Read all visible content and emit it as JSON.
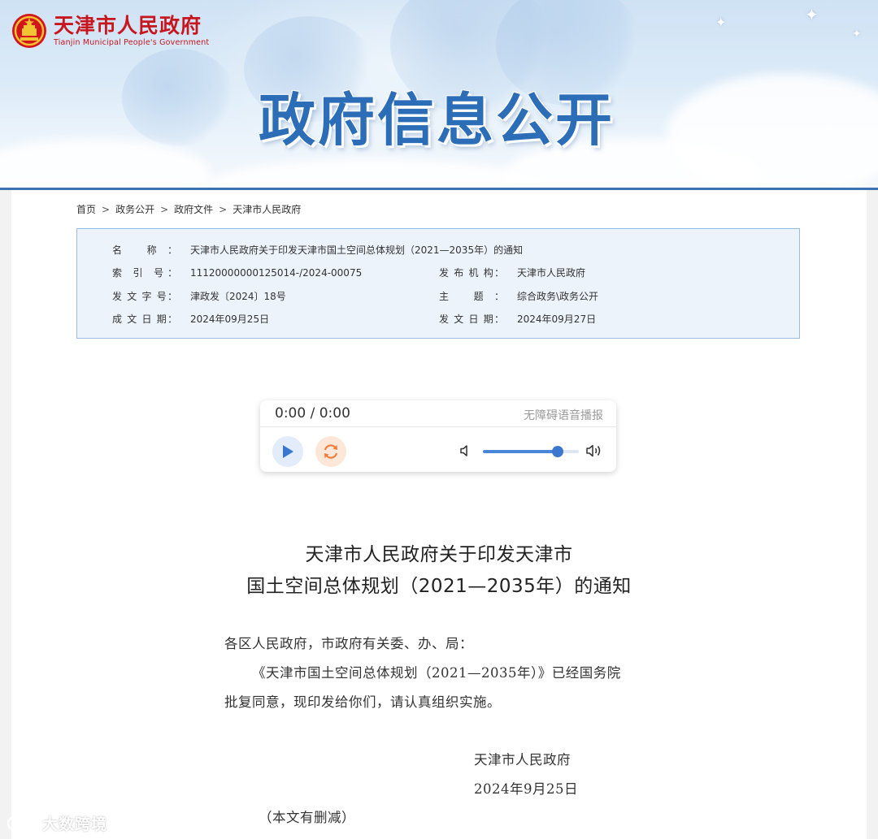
{
  "header": {
    "site_name_cn": "天津市人民政府",
    "site_name_en": "Tianjin Municipal People's Government",
    "banner_title": "政府信息公开"
  },
  "breadcrumb": [
    "首页",
    "政务公开",
    "政府文件",
    "天津市人民政府"
  ],
  "meta": {
    "name_label": "名 称：",
    "name_value": "天津市人民政府关于印发天津市国土空间总体规划（2021—2035年）的通知",
    "index_label": "索 引 号：",
    "index_value": "11120000000125014-/2024-00075",
    "issuer_label": "发 布 机 构：",
    "issuer_value": "天津市人民政府",
    "doc_no_label": "发 文 字 号：",
    "doc_no_value": "津政发〔2024〕18号",
    "topic_label": "主 题：",
    "topic_value": "综合政务\\政务公开",
    "created_label": "成 文 日 期：",
    "created_value": "2024年09月25日",
    "published_label": "发 文 日 期：",
    "published_value": "2024年09月27日"
  },
  "player": {
    "time": "0:00 / 0:00",
    "tts_label": "无障碍语音播报",
    "volume": 0.78
  },
  "document": {
    "title_line1": "天津市人民政府关于印发天津市",
    "title_line2": "国土空间总体规划（2021—2035年）的通知",
    "salutation": "各区人民政府，市政府有关委、办、局：",
    "body_line1": "《天津市国土空间总体规划（2021—2035年）》已经国务院",
    "body_line2": "批复同意，现印发给你们，请认真组织实施。",
    "signature": "天津市人民政府",
    "date": "2024年9月25日",
    "note": "（本文有删减）"
  },
  "watermark": "大数跨境",
  "colors": {
    "brand_red": "#c8161e",
    "banner_blue": "#2c6db7",
    "accent_blue": "#3b76cf",
    "meta_bg": "#ecf3fb",
    "meta_border": "#9dbbe0",
    "loop_orange": "#ef7d3a"
  }
}
